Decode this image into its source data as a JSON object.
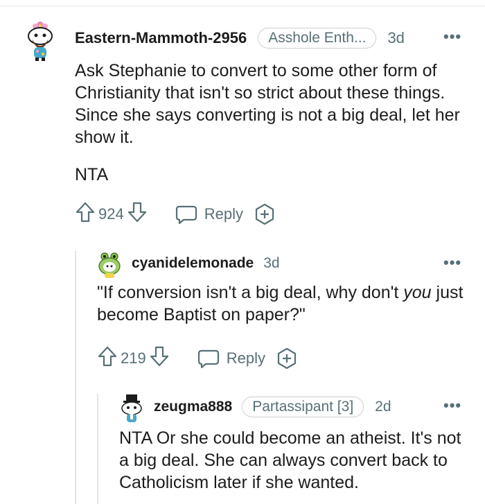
{
  "comments": [
    {
      "author": "Eastern-Mammoth-2956",
      "flair": "Asshole Enth...",
      "age": "3d",
      "more": "•••",
      "body": [
        "Ask Stephanie to convert to some other form of Christianity that isn't so strict about these things. Since she says converting is not a big deal, let her show it.",
        "NTA"
      ],
      "votes": "924",
      "reply_label": "Reply",
      "icons": {
        "avatar": "snoo-avatar-flower-hat",
        "upvote": "arrow-up-icon",
        "downvote": "arrow-down-icon",
        "reply": "speech-bubble-icon",
        "award": "add-award-icon",
        "more": "more-options-icon"
      }
    },
    {
      "author": "cyanidelemonade",
      "age": "3d",
      "more": "•••",
      "body_before": "\"If conversion isn't a big deal, why don't ",
      "body_emphasis": "you",
      "body_after": " just become Baptist on paper?\"",
      "votes": "219",
      "reply_label": "Reply",
      "icons": {
        "avatar": "snoo-avatar-frog-hood",
        "upvote": "arrow-up-icon",
        "downvote": "arrow-down-icon",
        "reply": "speech-bubble-icon",
        "award": "add-award-icon",
        "more": "more-options-icon"
      }
    },
    {
      "author": "zeugma888",
      "flair": "Partassipant [3]",
      "age": "2d",
      "more": "•••",
      "body": "NTA Or she could become an atheist. It's not a big deal. She can always convert back to Catholicism later if she wanted.",
      "icons": {
        "avatar": "snoo-avatar-top-hat",
        "more": "more-options-icon"
      }
    }
  ],
  "colors": {
    "text": "#1c1c1c",
    "meta": "#576f76",
    "thread_line": "#e3e3e3",
    "flair_border": "#cfcfcf"
  }
}
